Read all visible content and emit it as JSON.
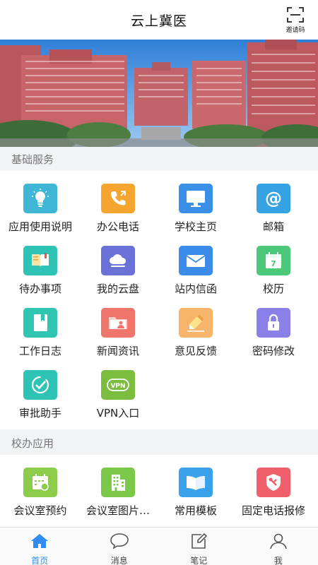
{
  "app": {
    "title": "云上冀医",
    "invite_label": "邀请码"
  },
  "sections": [
    {
      "title": "基础服务",
      "items": [
        {
          "label": "应用使用说明",
          "icon": "lightbulb-icon",
          "color": "#3fb6d6"
        },
        {
          "label": "办公电话",
          "icon": "phone-icon",
          "color": "#f6a531"
        },
        {
          "label": "学校主页",
          "icon": "monitor-icon",
          "color": "#3a8fe6"
        },
        {
          "label": "邮箱",
          "icon": "at-icon",
          "color": "#35a3e3"
        },
        {
          "label": "待办事项",
          "icon": "book-icon",
          "color": "#2ec3b4"
        },
        {
          "label": "我的云盘",
          "icon": "cloud-drive-icon",
          "color": "#6a72d8"
        },
        {
          "label": "站内信函",
          "icon": "envelope-icon",
          "color": "#3b8be8"
        },
        {
          "label": "校历",
          "icon": "calendar-icon",
          "color": "#4cc879"
        },
        {
          "label": "工作日志",
          "icon": "notebook-icon",
          "color": "#2fc5b1"
        },
        {
          "label": "新闻资讯",
          "icon": "news-icon",
          "color": "#f0756a"
        },
        {
          "label": "意见反馈",
          "icon": "pencil-icon",
          "color": "#f7b46b"
        },
        {
          "label": "密码修改",
          "icon": "lock-icon",
          "color": "#8b7fe8"
        },
        {
          "label": "审批助手",
          "icon": "approve-icon",
          "color": "#2ec3b4"
        },
        {
          "label": "VPN入口",
          "icon": "vpn-icon",
          "color": "#7bbd3e"
        }
      ]
    },
    {
      "title": "校办应用",
      "items": [
        {
          "label": "会议室预约",
          "icon": "meeting-calendar-icon",
          "color": "#8ccc4a"
        },
        {
          "label": "会议室图片…",
          "icon": "building-icon",
          "color": "#7cc94a"
        },
        {
          "label": "常用模板",
          "icon": "open-book-icon",
          "color": "#3aa2ea"
        },
        {
          "label": "固定电话报修",
          "icon": "repair-icon",
          "color": "#f0606a"
        }
      ]
    }
  ],
  "tabs": [
    {
      "label": "首页",
      "icon": "home-icon",
      "active": true
    },
    {
      "label": "消息",
      "icon": "message-icon",
      "active": false
    },
    {
      "label": "笔记",
      "icon": "note-icon",
      "active": false
    },
    {
      "label": "我",
      "icon": "user-icon",
      "active": false
    }
  ],
  "colors": {
    "accent": "#2f8cf0"
  }
}
